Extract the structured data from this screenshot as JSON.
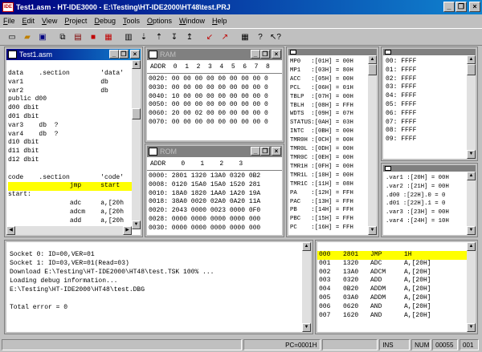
{
  "app": {
    "title": "Test1.asm - HT-IDE3000 - E:\\Testing\\HT-IDE2000\\HT48\\test.PRJ",
    "icon_text": "IDE"
  },
  "menu": [
    "File",
    "Edit",
    "View",
    "Project",
    "Debug",
    "Tools",
    "Options",
    "Window",
    "Help"
  ],
  "toolbar": [
    "new-icon",
    "open-icon",
    "save-icon",
    "copy-icon",
    "paste-icon",
    "build-icon",
    "rebuild-icon",
    "stop-icon",
    "step-into-icon",
    "step-over-icon",
    "step-out-icon",
    "run-to-icon",
    "reset-icon",
    "power-on-reset-icon",
    "print-icon",
    "help-icon",
    "context-help-icon"
  ],
  "source": {
    "title": "Test1.asm",
    "lines": [
      "data    .section        'data'",
      "var1                    db",
      "var2                    db",
      "public d00",
      "d00 dbit",
      "d01 dbit",
      "var3    db  ?",
      "var4    db  ?",
      "d10 dbit",
      "d11 dbit",
      "d12 dbit",
      "",
      "code    .section        'code'",
      "                jmp     start",
      "start:",
      "                adc     a,[20h",
      "                adcm    a,[20h",
      "                add     a,[20h"
    ],
    "highlight_line": 13
  },
  "ram": {
    "title": "RAM",
    "header": "ADDR  0  1  2  3  4  5  6  7  8",
    "rows": [
      "0020: 00 00 00 00 00 00 00 00 0",
      "0030: 00 00 00 00 00 00 00 00 0",
      "0040: 10 00 00 00 00 00 00 00 0",
      "0050: 00 00 00 00 00 00 00 00 0",
      "0060: 20 00 02 00 00 00 00 00 0",
      "0070: 00 00 00 00 00 00 00 00 0"
    ]
  },
  "rom": {
    "title": "ROM",
    "header": "ADDR    0    1    2    3",
    "rows": [
      "0000: 2801 1320 13A0 0320 0B2",
      "0008: 0120 15A0 15A0 1520 281",
      "0010: 18A0 1820 1AA0 1A20 19A",
      "0018: 38A0 0020 02A0 0A20 11A",
      "0020: 2043 0000 0023 0000 0F0",
      "0028: 0000 0000 0000 0000 000",
      "0030: 0000 0000 0000 0000 000"
    ]
  },
  "registers": {
    "rows": [
      "MP0   :[01H] = 00H",
      "MP1   :[03H] = 80H",
      "ACC   :[05H] = 00H",
      "PCL   :[06H] = 01H",
      "TBLP  :[07H] = 00H",
      "TBLH  :[08H] = FFH",
      "WDTS  :[09H] = 07H",
      "STATUS:[0AH] = 03H",
      "INTC  :[0BH] = 00H",
      "TMR0H :[0CH] = 00H",
      "TMR0L :[0DH] = 00H",
      "TMR0C :[0EH] = 00H",
      "TMR1H :[0FH] = 00H",
      "TMR1L :[10H] = 00H",
      "TMR1C :[11H] = 08H",
      "PA    :[12H] = FFH",
      "PAC   :[13H] = FFH",
      "PB    :[14H] = FFH",
      "PBC   :[15H] = FFH",
      "PC    :[16H] = FFH"
    ]
  },
  "stack": {
    "rows": [
      "00: FFFF",
      "01: FFFF",
      "02: FFFF",
      "03: FFFF",
      "04: FFFF",
      "05: FFFF",
      "06: FFFF",
      "07: FFFF",
      "08: FFFF",
      "09: FFFF"
    ]
  },
  "watch": {
    "rows": [
      ".var1 :[20H] = 00H",
      ".var2 :[21H] = 00H",
      ".d00 :[22H].0 = 0",
      ".d01 :[22H].1 = 0",
      ".var3 :[23H] = 00H",
      ".var4 :[24H] = 10H"
    ]
  },
  "output": {
    "lines": [
      "Socket 0: ID=00,VER=01",
      "Socket 1: ID=03,VER=01(Read=03)",
      "Download E:\\Testing\\HT-IDE2000\\HT48\\test.TSK 100% ...",
      "Loading debug information...",
      "E:\\Testing\\HT-IDE2000\\HT48\\test.DBG",
      "",
      "Total error = 0"
    ]
  },
  "disasm": {
    "rows": [
      [
        "000",
        "2801",
        "JMP",
        "1H"
      ],
      [
        "001",
        "1320",
        "ADC",
        "A,[20H]"
      ],
      [
        "002",
        "13A0",
        "ADCM",
        "A,[20H]"
      ],
      [
        "003",
        "0320",
        "ADD",
        "A,[20H]"
      ],
      [
        "004",
        "0B20",
        "ADDM",
        "A,[20H]"
      ],
      [
        "005",
        "03A0",
        "ADDM",
        "A,[20H]"
      ],
      [
        "006",
        "0620",
        "AND",
        "A,[20H]"
      ],
      [
        "007",
        "1620",
        "AND",
        "A,[20H]"
      ]
    ],
    "highlight_row": 0
  },
  "status": {
    "pc": "PC=0001H",
    "ins": "INS",
    "num": "NUM",
    "count": "00055",
    "extra": "001"
  },
  "colors": {
    "highlight": "#ffff00",
    "title_active": "#000080",
    "face": "#c0c0c0"
  }
}
